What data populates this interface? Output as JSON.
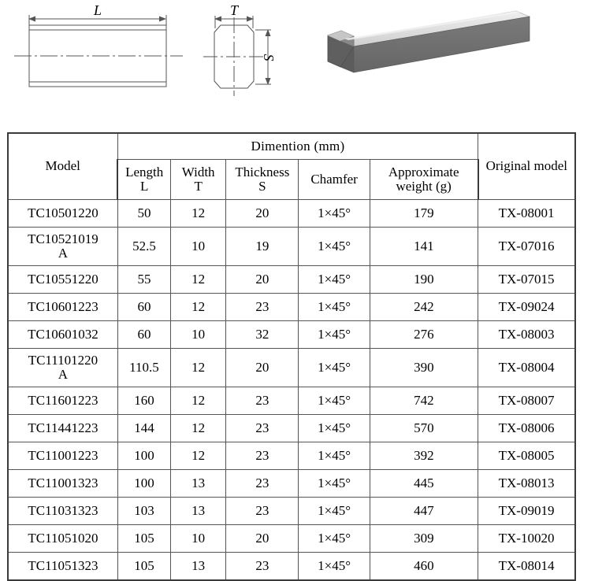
{
  "drawings": {
    "side_view": {
      "name": "side-view-bar",
      "dimension_label": "L"
    },
    "cross_section": {
      "name": "cross-section-view",
      "width_label": "T",
      "height_label": "S"
    },
    "render_3d": {
      "name": "isometric-bar-render",
      "top_face_color": "#d9d9d9",
      "front_face_color": "#6e6e6e",
      "end_face_color": "#565656"
    }
  },
  "table": {
    "headers": {
      "model": "Model",
      "dimension_group": "Dimention (mm)",
      "length": "Length\nL",
      "width": "Width\nT",
      "thickness": "Thickness\nS",
      "chamfer": "Chamfer",
      "weight": "Approximate weight (g)",
      "original_model": "Original model"
    },
    "rows": [
      {
        "model": "TC10501220",
        "length": "50",
        "width": "12",
        "thickness": "20",
        "chamfer": "1×45°",
        "weight": "179",
        "original": "TX-08001",
        "tall": false
      },
      {
        "model": "TC10521019\nA",
        "length": "52.5",
        "width": "10",
        "thickness": "19",
        "chamfer": "1×45°",
        "weight": "141",
        "original": "TX-07016",
        "tall": true
      },
      {
        "model": "TC10551220",
        "length": "55",
        "width": "12",
        "thickness": "20",
        "chamfer": "1×45°",
        "weight": "190",
        "original": "TX-07015",
        "tall": false
      },
      {
        "model": "TC10601223",
        "length": "60",
        "width": "12",
        "thickness": "23",
        "chamfer": "1×45°",
        "weight": "242",
        "original": "TX-09024",
        "tall": false
      },
      {
        "model": "TC10601032",
        "length": "60",
        "width": "10",
        "thickness": "32",
        "chamfer": "1×45°",
        "weight": "276",
        "original": "TX-08003",
        "tall": false
      },
      {
        "model": "TC11101220\nA",
        "length": "110.5",
        "width": "12",
        "thickness": "20",
        "chamfer": "1×45°",
        "weight": "390",
        "original": "TX-08004",
        "tall": true
      },
      {
        "model": "TC11601223",
        "length": "160",
        "width": "12",
        "thickness": "23",
        "chamfer": "1×45°",
        "weight": "742",
        "original": "TX-08007",
        "tall": false
      },
      {
        "model": "TC11441223",
        "length": "144",
        "width": "12",
        "thickness": "23",
        "chamfer": "1×45°",
        "weight": "570",
        "original": "TX-08006",
        "tall": false
      },
      {
        "model": "TC11001223",
        "length": "100",
        "width": "12",
        "thickness": "23",
        "chamfer": "1×45°",
        "weight": "392",
        "original": "TX-08005",
        "tall": false
      },
      {
        "model": "TC11001323",
        "length": "100",
        "width": "13",
        "thickness": "23",
        "chamfer": "1×45°",
        "weight": "445",
        "original": "TX-08013",
        "tall": false
      },
      {
        "model": "TC11031323",
        "length": "103",
        "width": "13",
        "thickness": "23",
        "chamfer": "1×45°",
        "weight": "447",
        "original": "TX-09019",
        "tall": false
      },
      {
        "model": "TC11051020",
        "length": "105",
        "width": "10",
        "thickness": "20",
        "chamfer": "1×45°",
        "weight": "309",
        "original": "TX-10020",
        "tall": false
      },
      {
        "model": "TC11051323",
        "length": "105",
        "width": "13",
        "thickness": "23",
        "chamfer": "1×45°",
        "weight": "460",
        "original": "TX-08014",
        "tall": false
      }
    ]
  },
  "colors": {
    "border": "#555555",
    "outer_border": "#3a3a3a",
    "text": "#000000",
    "background": "#ffffff",
    "drawing_line": "#555555"
  }
}
